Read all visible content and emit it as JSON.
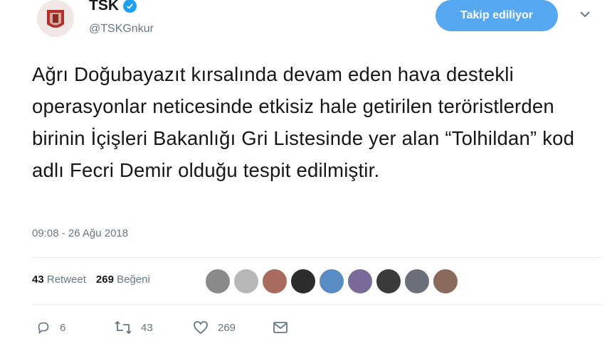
{
  "account": {
    "name": "TSK",
    "handle": "@TSKGnkur"
  },
  "follow_button_label": "Takip ediliyor",
  "tweet": {
    "text": "Ağrı Doğubayazıt kırsalında devam eden hava destekli operasyonlar neticesinde etkisiz hale getirilen teröristlerden birinin İçişleri Bakanlığı Gri Listesinde yer alan “Tolhildan” kod adlı Fecri Demir olduğu tespit edilmiştir.",
    "timestamp": "09:08 - 26 Ağu 2018"
  },
  "stats": {
    "retweets_count": "43",
    "retweets_label": "Retweet",
    "likes_count": "269",
    "likes_label": "Beğeni"
  },
  "liker_avatar_colors": [
    "#8a8a8a",
    "#b7b7b7",
    "#a86b5e",
    "#2c2c2c",
    "#5a8cc4",
    "#7a6a9a",
    "#3b3b3b",
    "#6b6f7a",
    "#8a6a5a"
  ],
  "actions": {
    "reply_count": "6",
    "retweet_count": "43",
    "like_count": "269"
  },
  "colors": {
    "accent": "#1da1f2",
    "follow_button": "#56a9f0",
    "muted_text": "#657786"
  },
  "icons": [
    "verified-badge-icon",
    "chevron-down-icon",
    "reply-icon",
    "retweet-icon",
    "like-heart-icon",
    "direct-message-icon"
  ]
}
